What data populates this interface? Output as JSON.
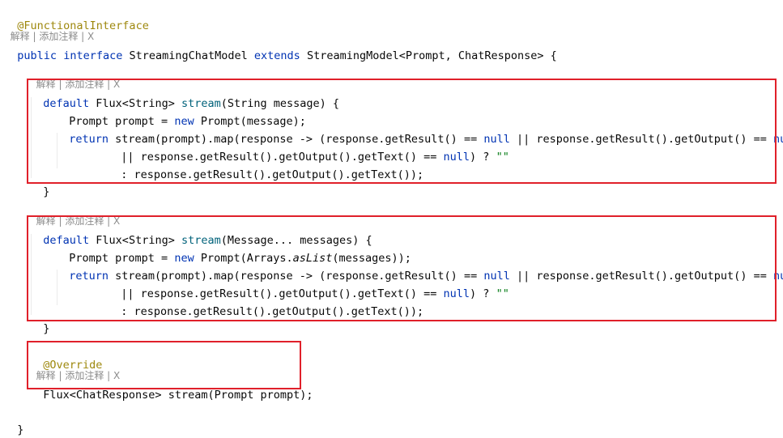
{
  "lens": {
    "explain": "解释",
    "add_comment": "添加注释",
    "close": "X",
    "sep": " | "
  },
  "code": {
    "l_annotation": "@FunctionalInterface",
    "l_iface_kw1": "public",
    "l_iface_kw2": "interface",
    "l_iface_name": " StreamingChatModel ",
    "l_iface_kw3": "extends",
    "l_iface_rest": " StreamingModel<Prompt, ChatResponse> {",
    "m1_sig": {
      "kw": "default",
      "type": " Flux<String> ",
      "name": "stream",
      "params": "(String message) {"
    },
    "m1_l2": {
      "pre": "Prompt prompt = ",
      "kw": "new",
      "post": " Prompt(message);"
    },
    "m2_sig": {
      "kw": "default",
      "type": " Flux<String> ",
      "name": "stream",
      "params": "(Message... messages) {"
    },
    "m2_l2": {
      "pre": "Prompt prompt = ",
      "kw": "new",
      "post": " Prompt(Arrays.",
      "italic": "asList",
      "post2": "(messages));"
    },
    "ret": {
      "kw": "return",
      "a": " stream(prompt).map(response -> (response.getResult() == ",
      "null1": "null",
      "b": " || response.getResult().getOutput() == ",
      "null2": "null"
    },
    "cond2": {
      "a": "|| response.getResult().getOutput().getText() == ",
      "null": "null",
      "b": ") ? ",
      "str": "\"\""
    },
    "cond3": ": response.getResult().getOutput().getText());",
    "close_brace": "}",
    "override": "@Override",
    "m3": "Flux<ChatResponse> stream(Prompt prompt);",
    "final_brace": "}"
  }
}
